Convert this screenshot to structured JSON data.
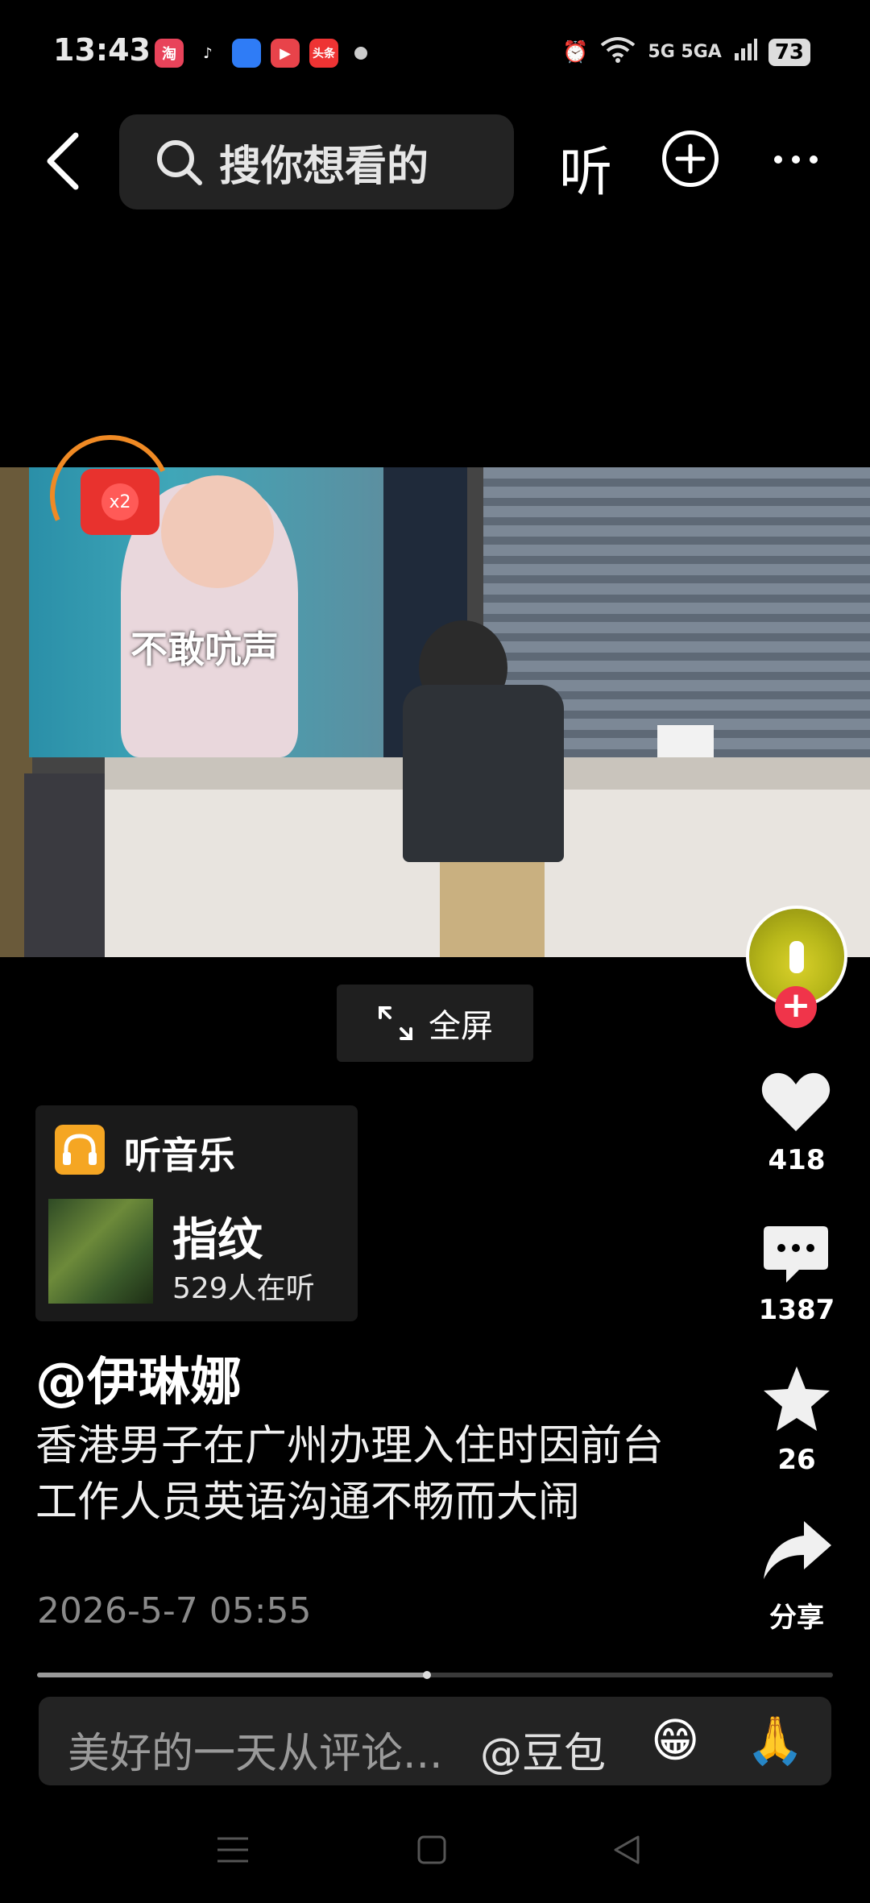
{
  "status_bar": {
    "time": "13:43",
    "apps": [
      "淘",
      "♪",
      "",
      "▶",
      "头条"
    ],
    "network": "5G 5GA",
    "battery": "73"
  },
  "top_bar": {
    "search_placeholder": "搜你想看的",
    "listen_label": "听"
  },
  "video": {
    "overlay_text": "不敢吭声",
    "red_packet_label": "x2",
    "fullscreen_label": "全屏"
  },
  "right_rail": {
    "like_count": "418",
    "comment_count": "1387",
    "favorite_count": "26",
    "share_label": "分享"
  },
  "music": {
    "header": "听音乐",
    "song": "指纹",
    "listeners": "529人在听"
  },
  "post": {
    "author": "@伊琳娜",
    "caption": "香港男子在广州办理入住时因前台工作人员英语沟通不畅而大闹",
    "date": "2026-5-7 05:55",
    "progress": 0.49
  },
  "comment_bar": {
    "placeholder": "美好的一天从评论...",
    "mention": "@豆包",
    "emoji_1": "😁",
    "emoji_2": "🙏"
  }
}
